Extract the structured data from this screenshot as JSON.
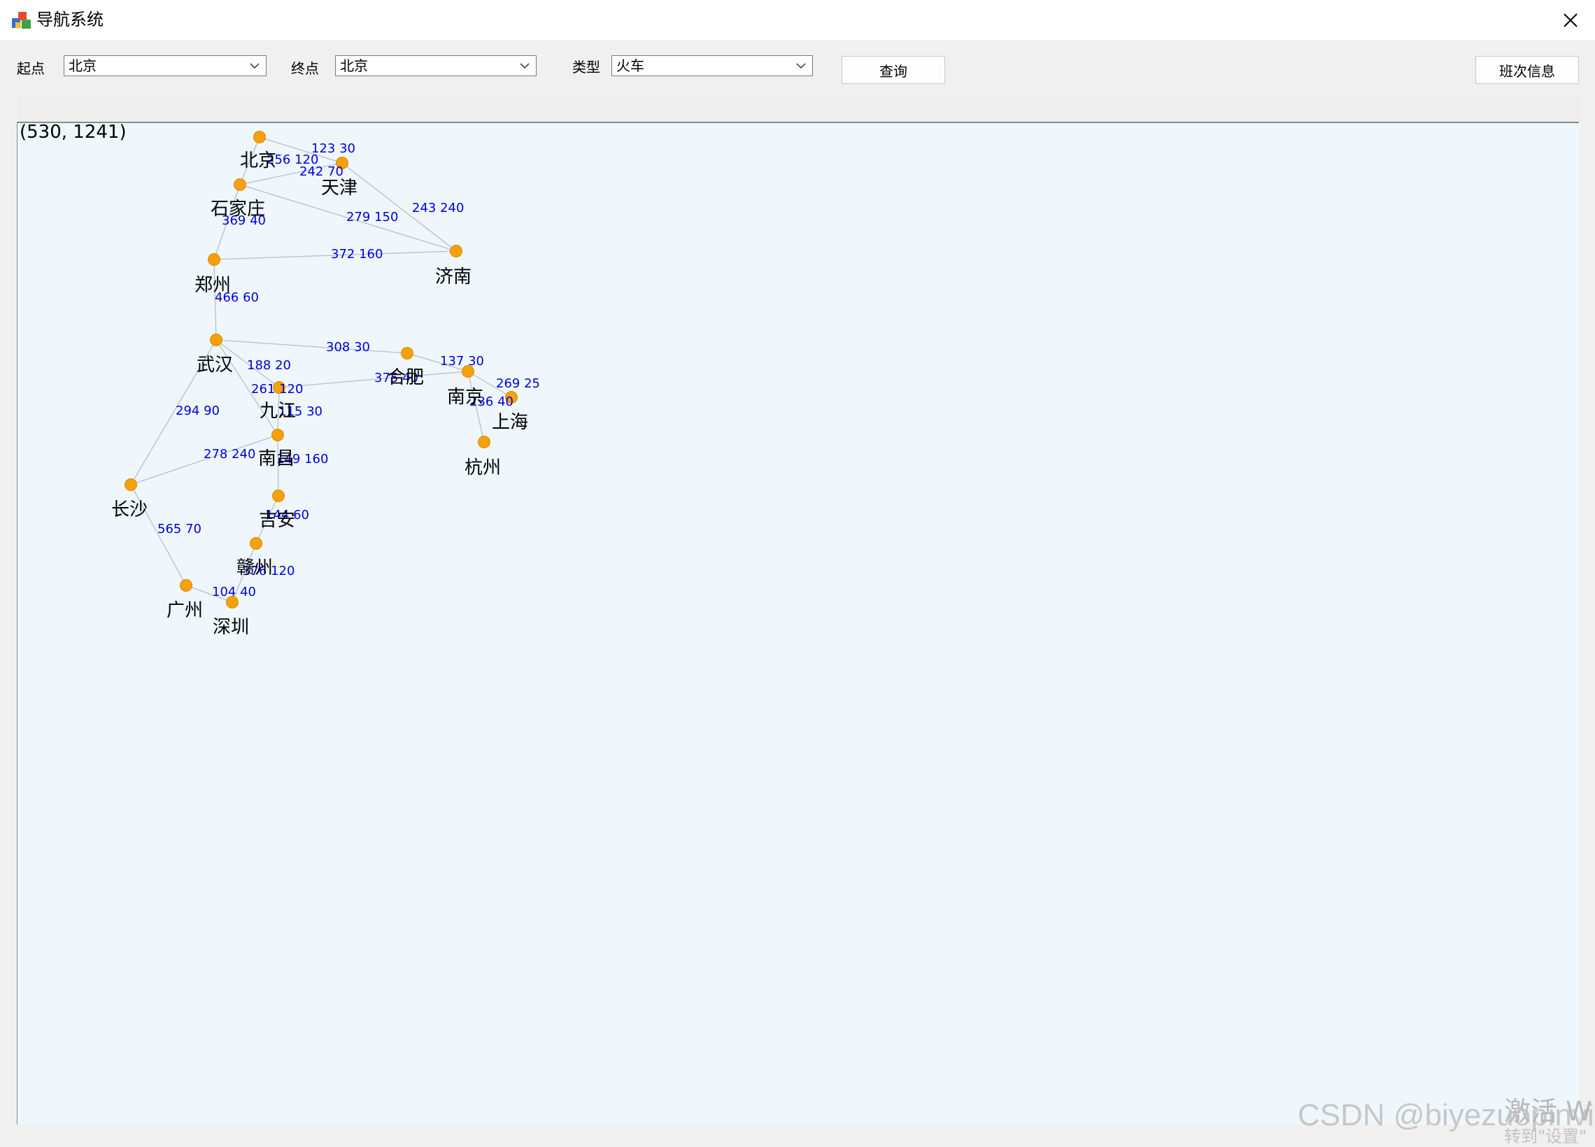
{
  "window": {
    "title": "导航系统"
  },
  "toolbar": {
    "start_label": "起点",
    "start_value": "北京",
    "end_label": "终点",
    "end_value": "北京",
    "type_label": "类型",
    "type_value": "火车",
    "query_label": "查询",
    "schedule_label": "班次信息"
  },
  "canvas": {
    "coord_readout": "(530, 1241)"
  },
  "graph": {
    "cities": [
      {
        "id": "beijing",
        "name": "北京"
      },
      {
        "id": "tianjin",
        "name": "天津"
      },
      {
        "id": "shijiazhuang",
        "name": "石家庄"
      },
      {
        "id": "jinan",
        "name": "济南"
      },
      {
        "id": "zhengzhou",
        "name": "郑州"
      },
      {
        "id": "wuhan",
        "name": "武汉"
      },
      {
        "id": "hefei",
        "name": "合肥"
      },
      {
        "id": "nanjing",
        "name": "南京"
      },
      {
        "id": "shanghai",
        "name": "上海"
      },
      {
        "id": "hangzhou",
        "name": "杭州"
      },
      {
        "id": "jiujiang",
        "name": "九江"
      },
      {
        "id": "nanchang",
        "name": "南昌"
      },
      {
        "id": "changsha",
        "name": "长沙"
      },
      {
        "id": "jian",
        "name": "吉安"
      },
      {
        "id": "ganzhou",
        "name": "赣州"
      },
      {
        "id": "guangzhou",
        "name": "广州"
      },
      {
        "id": "shenzhen",
        "name": "深圳"
      }
    ],
    "edges": [
      {
        "from": "beijing",
        "to": "tianjin",
        "label": "123  30"
      },
      {
        "from": "beijing",
        "to": "shijiazhuang",
        "label": "256  120"
      },
      {
        "from": "tianjin",
        "to": "shijiazhuang",
        "label": "242  70"
      },
      {
        "from": "tianjin",
        "to": "jinan",
        "label": "243  240"
      },
      {
        "from": "shijiazhuang",
        "to": "jinan",
        "label": "279  150"
      },
      {
        "from": "shijiazhuang",
        "to": "zhengzhou",
        "label": "369  40"
      },
      {
        "from": "zhengzhou",
        "to": "jinan",
        "label": "372  160"
      },
      {
        "from": "zhengzhou",
        "to": "wuhan",
        "label": "466  60"
      },
      {
        "from": "wuhan",
        "to": "hefei",
        "label": "308  30"
      },
      {
        "from": "wuhan",
        "to": "jiujiang",
        "label": "188  20"
      },
      {
        "from": "wuhan",
        "to": "nanchang",
        "label": "261  120"
      },
      {
        "from": "wuhan",
        "to": "changsha",
        "label": "294  90"
      },
      {
        "from": "jiujiang",
        "to": "nanjing",
        "label": "375  40"
      },
      {
        "from": "jiujiang",
        "to": "nanchang",
        "label": "115  30"
      },
      {
        "from": "hefei",
        "to": "nanjing",
        "label": "137  30"
      },
      {
        "from": "nanjing",
        "to": "shanghai",
        "label": "269  25"
      },
      {
        "from": "nanjing",
        "to": "hangzhou",
        "label": "236  40"
      },
      {
        "from": "nanchang",
        "to": "changsha",
        "label": "278  240"
      },
      {
        "from": "nanchang",
        "to": "jian",
        "label": "149  160"
      },
      {
        "from": "jian",
        "to": "ganzhou",
        "label": "144  60"
      },
      {
        "from": "changsha",
        "to": "guangzhou",
        "label": "565  70"
      },
      {
        "from": "ganzhou",
        "to": "shenzhen",
        "label": "376  120"
      },
      {
        "from": "guangzhou",
        "to": "shenzhen",
        "label": "104  40"
      }
    ]
  },
  "watermark": {
    "text": "CSDN @biyezuopinvip",
    "overlay_line1": "激活 W",
    "overlay_line2": "转到\"设置\""
  },
  "colors": {
    "node_fill": "#f5a10a",
    "edge_label": "#0000dd",
    "edge_line": "#b4c0cc",
    "canvas_bg": "#eff7fd"
  }
}
